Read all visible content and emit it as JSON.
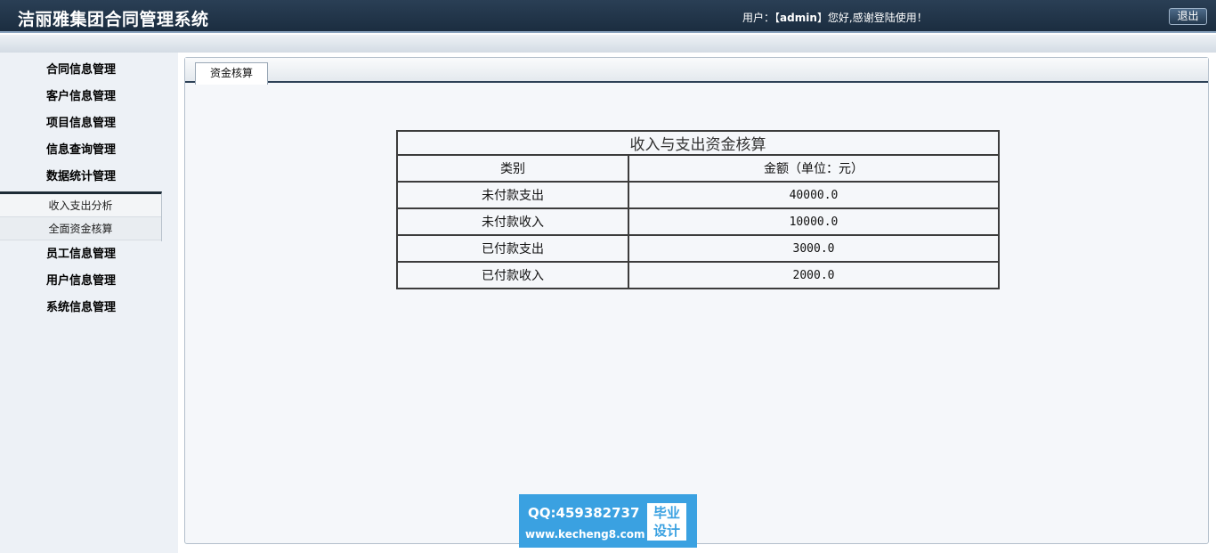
{
  "header": {
    "app_title": "洁丽雅集团合同管理系统",
    "user_prefix": "用户：【",
    "username": "admin",
    "user_suffix": "】您好,感谢登陆使用！",
    "logout_label": "退出"
  },
  "sidebar": {
    "items": [
      {
        "label": "合同信息管理"
      },
      {
        "label": "客户信息管理"
      },
      {
        "label": "项目信息管理"
      },
      {
        "label": "信息查询管理"
      },
      {
        "label": "数据统计管理"
      },
      {
        "label": "员工信息管理"
      },
      {
        "label": "用户信息管理"
      },
      {
        "label": "系统信息管理"
      }
    ],
    "submenu": [
      {
        "label": "收入支出分析"
      },
      {
        "label": "全面资金核算"
      }
    ]
  },
  "main": {
    "tab_label": "资金核算",
    "table": {
      "caption": "收入与支出资金核算",
      "headers": [
        "类别",
        "金额（单位：元）"
      ],
      "rows": [
        [
          "未付款支出",
          "40000.0"
        ],
        [
          "未付款收入",
          "10000.0"
        ],
        [
          "已付款支出",
          "3000.0"
        ],
        [
          "已付款收入",
          "2000.0"
        ]
      ]
    }
  },
  "watermark": {
    "qq": "QQ:459382737",
    "url": "www.kecheng8.com",
    "badge_line1": "毕业",
    "badge_line2": "设计"
  }
}
